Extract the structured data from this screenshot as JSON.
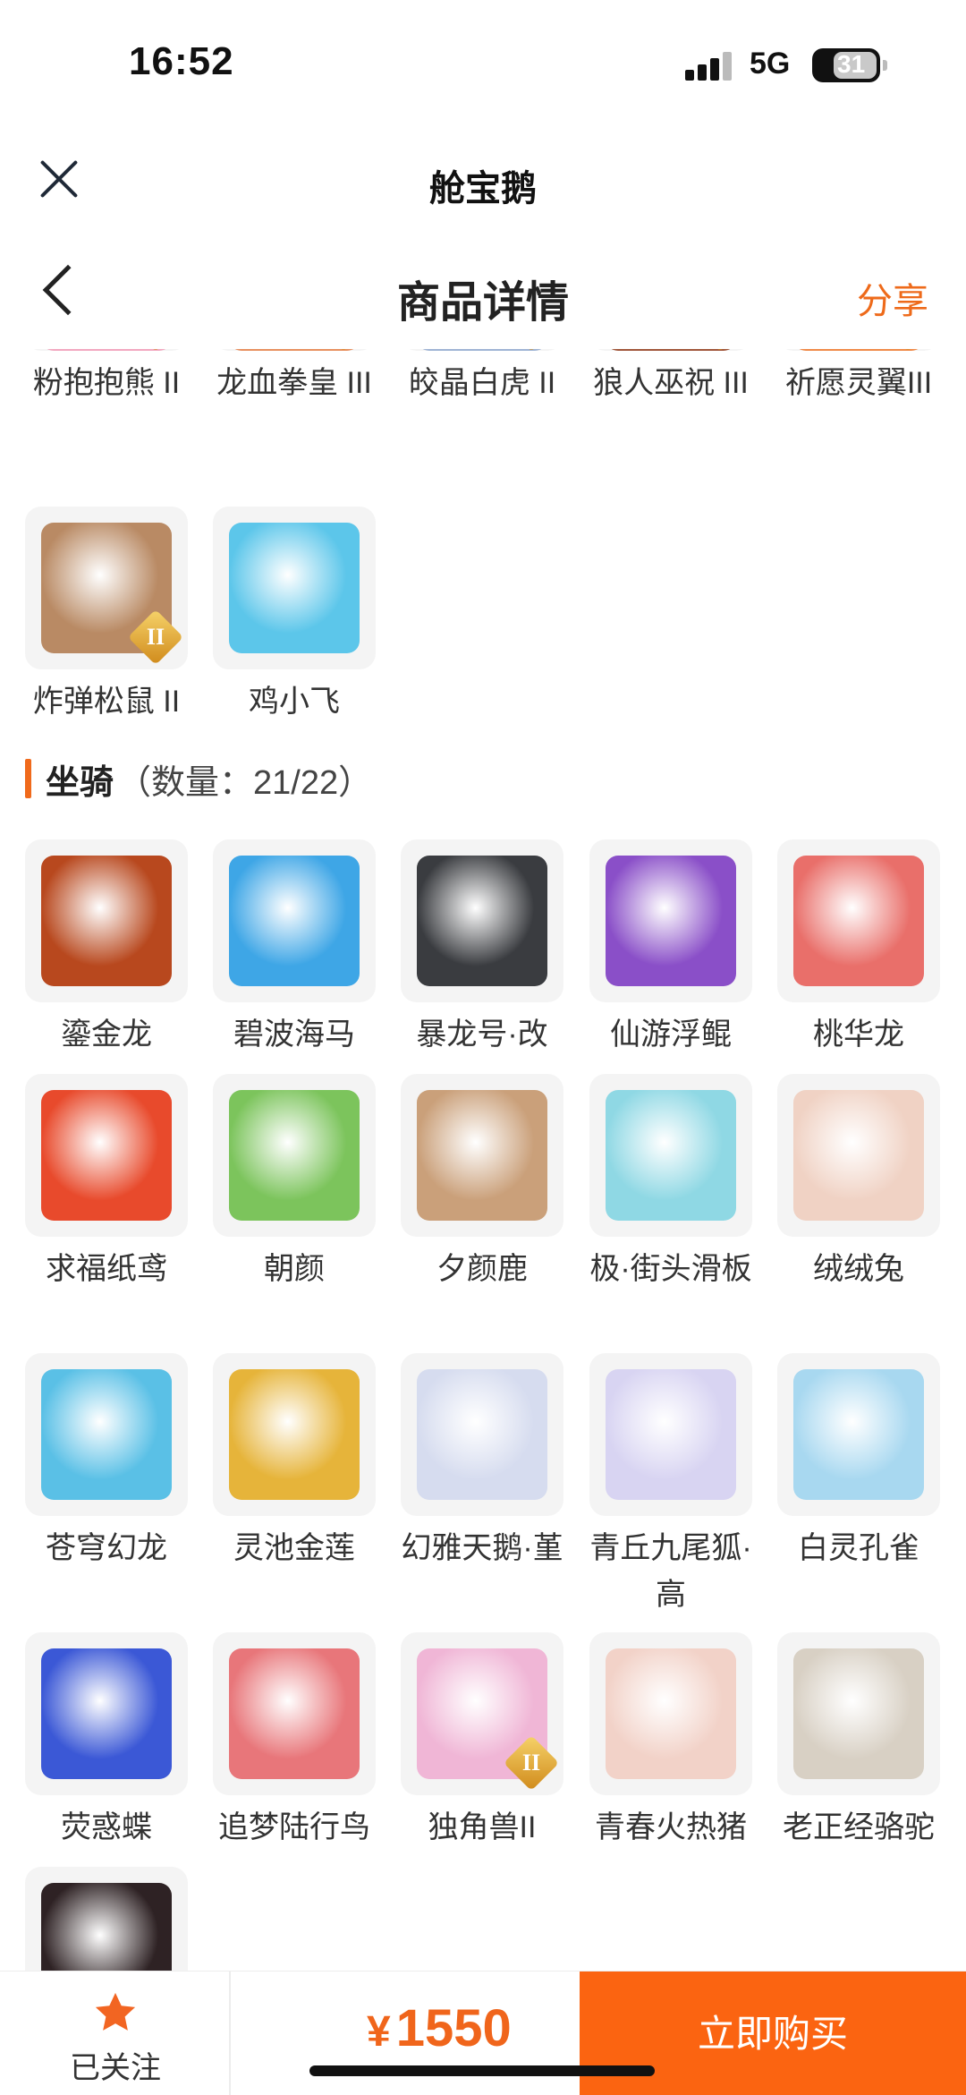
{
  "status_bar": {
    "time": "16:52",
    "network": "5G",
    "battery": "31"
  },
  "mp_header": {
    "title": "舱宝鹅"
  },
  "page_nav": {
    "title": "商品详情",
    "share_label": "分享"
  },
  "top_items": [
    {
      "name": "粉抱抱熊 II",
      "tier": "II",
      "color": "#f2a8c0"
    },
    {
      "name": "龙血拳皇 III",
      "tier": "III",
      "color": "#e89060"
    },
    {
      "name": "皎晶白虎 II",
      "tier": "II",
      "color": "#9fb4d4"
    },
    {
      "name": "狼人巫祝 III",
      "tier": "III",
      "color": "#a0563a"
    },
    {
      "name": "祈愿灵翼III",
      "tier": "III",
      "color": "#f08a48"
    },
    {
      "name": "炸弹松鼠 II",
      "tier": "II",
      "color": "#b98a64"
    },
    {
      "name": "鸡小飞",
      "tier": "",
      "color": "#5cc6ea"
    }
  ],
  "mounts_section": {
    "label": "坐骑",
    "count": "（数量：21/22）"
  },
  "mounts": [
    {
      "name": "鎏金龙",
      "tier": "",
      "color": "#b8481e"
    },
    {
      "name": "碧波海马",
      "tier": "",
      "color": "#3ea6e6"
    },
    {
      "name": "暴龙号·改",
      "tier": "",
      "color": "#3a3c40"
    },
    {
      "name": "仙游浮鲲",
      "tier": "",
      "color": "#8a4fc8"
    },
    {
      "name": "桃华龙",
      "tier": "",
      "color": "#e96f6a"
    },
    {
      "name": "求福纸鸢",
      "tier": "",
      "color": "#e84a2c"
    },
    {
      "name": "朝颜",
      "tier": "",
      "color": "#7cc45c"
    },
    {
      "name": "夕颜鹿",
      "tier": "",
      "color": "#caa07a"
    },
    {
      "name": "极·街头滑板",
      "tier": "",
      "color": "#8fd8e4"
    },
    {
      "name": "绒绒兔",
      "tier": "",
      "color": "#f0d2c4"
    },
    {
      "name": "苍穹幻龙",
      "tier": "",
      "color": "#5ac0e6"
    },
    {
      "name": "灵池金莲",
      "tier": "",
      "color": "#e6b43a"
    },
    {
      "name": "幻雅天鹅·堇",
      "tier": "",
      "color": "#d6dcef"
    },
    {
      "name": "青丘九尾狐·高",
      "tier": "",
      "color": "#d8d4f2"
    },
    {
      "name": "白灵孔雀",
      "tier": "",
      "color": "#a8d8f0"
    },
    {
      "name": "荧惑蝶",
      "tier": "",
      "color": "#3b58d6"
    },
    {
      "name": "追梦陆行鸟",
      "tier": "",
      "color": "#e8767a"
    },
    {
      "name": "独角兽II",
      "tier": "II",
      "color": "#f0b6d6"
    },
    {
      "name": "青春火热猪",
      "tier": "",
      "color": "#f2d2c8"
    },
    {
      "name": "老正经骆驼",
      "tier": "",
      "color": "#d8d0c4"
    },
    {
      "name": "",
      "tier": "",
      "color": "#2e2224"
    }
  ],
  "bottom_bar": {
    "follow_label": "已关注",
    "price_symbol": "¥",
    "price": "1550",
    "buy_label": "立即购买"
  },
  "colors": {
    "accent": "#fb6411",
    "star": "#f26522"
  }
}
